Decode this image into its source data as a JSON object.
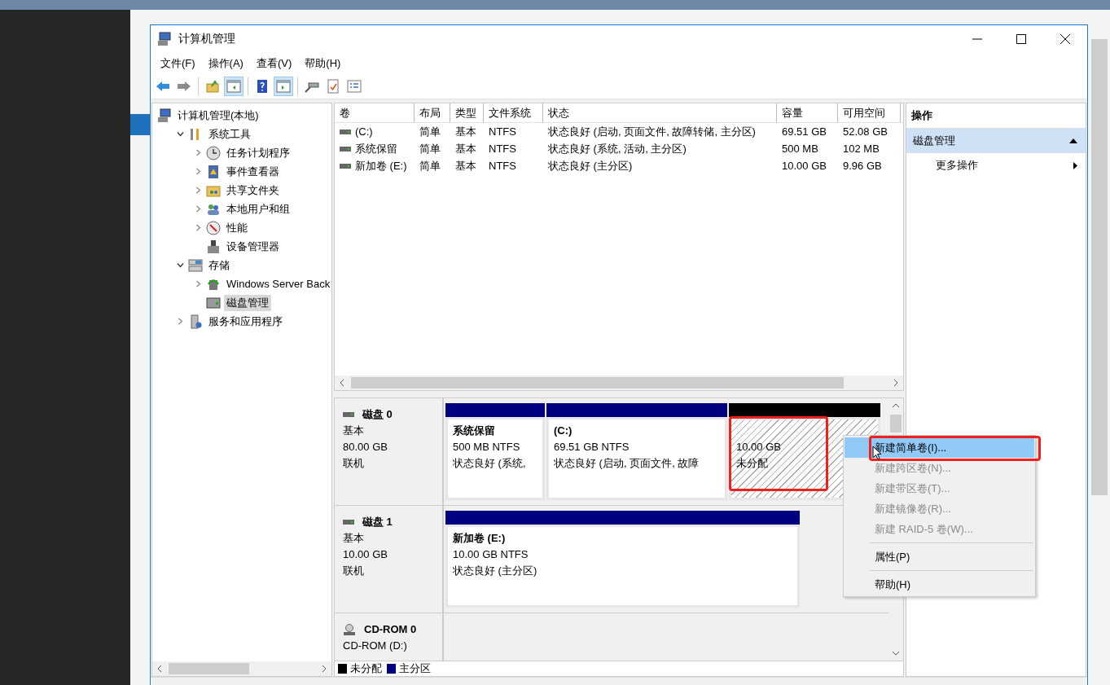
{
  "window": {
    "title": "计算机管理"
  },
  "menu": [
    "文件(F)",
    "操作(A)",
    "查看(V)",
    "帮助(H)"
  ],
  "toolbar": [
    {
      "kind": "back",
      "disabled": false
    },
    {
      "kind": "forward",
      "disabled": true
    },
    {
      "kind": "up"
    },
    {
      "kind": "tree-toggle",
      "pressed": true
    },
    {
      "kind": "help"
    },
    {
      "kind": "pane-toggle",
      "pressed": true
    },
    {
      "kind": "connect"
    },
    {
      "kind": "checklist"
    },
    {
      "kind": "properties"
    }
  ],
  "tree": [
    {
      "kind": "computer",
      "label": "计算机管理(本地)",
      "selected": false,
      "children": [
        {
          "kind": "tools",
          "label": "系统工具",
          "expanded": true,
          "selected": false,
          "children": [
            {
              "kind": "clock",
              "label": "任务计划程序",
              "expanded": false,
              "selected": false
            },
            {
              "kind": "log",
              "label": "事件查看器",
              "expanded": false,
              "selected": false
            },
            {
              "kind": "share",
              "label": "共享文件夹",
              "expanded": false,
              "selected": false
            },
            {
              "kind": "users",
              "label": "本地用户和组",
              "expanded": false,
              "selected": false
            },
            {
              "kind": "gauge",
              "label": "性能",
              "expanded": false,
              "selected": false
            },
            {
              "kind": "device",
              "label": "设备管理器",
              "selected": false
            }
          ]
        },
        {
          "kind": "storage",
          "label": "存储",
          "expanded": true,
          "selected": false,
          "children": [
            {
              "kind": "backup",
              "label": "Windows Server Back",
              "expanded": false,
              "selected": false
            },
            {
              "kind": "drive",
              "label": "磁盘管理",
              "selected": true
            }
          ]
        },
        {
          "kind": "server",
          "label": "服务和应用程序",
          "expanded": false,
          "selected": false
        }
      ]
    }
  ],
  "table": {
    "columns": [
      "卷",
      "布局",
      "类型",
      "文件系统",
      "状态",
      "容量",
      "可用空间"
    ],
    "rows": [
      {
        "cells": [
          "(C:)",
          "简单",
          "基本",
          "NTFS",
          "状态良好 (启动, 页面文件, 故障转储, 主分区)",
          "69.51 GB",
          "52.08 GB"
        ]
      },
      {
        "cells": [
          "系统保留",
          "简单",
          "基本",
          "NTFS",
          "状态良好 (系统, 活动, 主分区)",
          "500 MB",
          "102 MB"
        ]
      },
      {
        "cells": [
          "新加卷 (E:)",
          "简单",
          "基本",
          "NTFS",
          "状态良好 (主分区)",
          "10.00 GB",
          "9.96 GB"
        ]
      }
    ]
  },
  "disks": [
    {
      "kind": "disk",
      "name": "磁盘 0",
      "type": "基本",
      "size": "80.00 GB",
      "status": "联机",
      "partitions": [
        {
          "kind": "primary",
          "title": "系统保留",
          "size": "500 MB NTFS",
          "status": "状态良好 (系统,",
          "highlighted": false
        },
        {
          "kind": "primary",
          "title": "(C:)",
          "size": "69.51 GB NTFS",
          "status": "状态良好 (启动, 页面文件, 故障",
          "highlighted": false
        },
        {
          "kind": "unallocated",
          "size": "10.00 GB",
          "status": "未分配",
          "highlighted": true
        }
      ]
    },
    {
      "kind": "disk",
      "name": "磁盘 1",
      "type": "基本",
      "size": "10.00 GB",
      "status": "联机",
      "partitions": [
        {
          "kind": "primary",
          "title": "新加卷 (E:)",
          "size": "10.00 GB NTFS",
          "status": "状态良好 (主分区)",
          "highlighted": false
        }
      ]
    },
    {
      "kind": "cdrom",
      "name": "CD-ROM 0",
      "drive": "CD-ROM (D:)"
    }
  ],
  "legend": [
    {
      "label": "未分配",
      "color": "#000000"
    },
    {
      "label": "主分区",
      "color": "#000080"
    }
  ],
  "actions": {
    "title": "操作",
    "sections": [
      {
        "title": "磁盘管理",
        "expanded": true,
        "items": [
          {
            "label": "更多操作",
            "submenu": true
          }
        ]
      }
    ]
  },
  "context_menu": {
    "items": [
      {
        "kind": "item",
        "label": "新建简单卷(I)...",
        "disabled": false,
        "selected": true,
        "highlighted": true
      },
      {
        "kind": "item",
        "label": "新建跨区卷(N)...",
        "disabled": true,
        "selected": false,
        "highlighted": false
      },
      {
        "kind": "item",
        "label": "新建带区卷(T)...",
        "disabled": true,
        "selected": false,
        "highlighted": false
      },
      {
        "kind": "item",
        "label": "新建镜像卷(R)...",
        "disabled": true,
        "selected": false,
        "highlighted": false
      },
      {
        "kind": "item",
        "label": "新建 RAID-5 卷(W)...",
        "disabled": true,
        "selected": false,
        "highlighted": false
      },
      {
        "kind": "separator"
      },
      {
        "kind": "item",
        "label": "属性(P)",
        "disabled": false,
        "selected": false,
        "highlighted": false
      },
      {
        "kind": "separator"
      },
      {
        "kind": "item",
        "label": "帮助(H)",
        "disabled": false,
        "selected": false,
        "highlighted": false
      }
    ]
  }
}
